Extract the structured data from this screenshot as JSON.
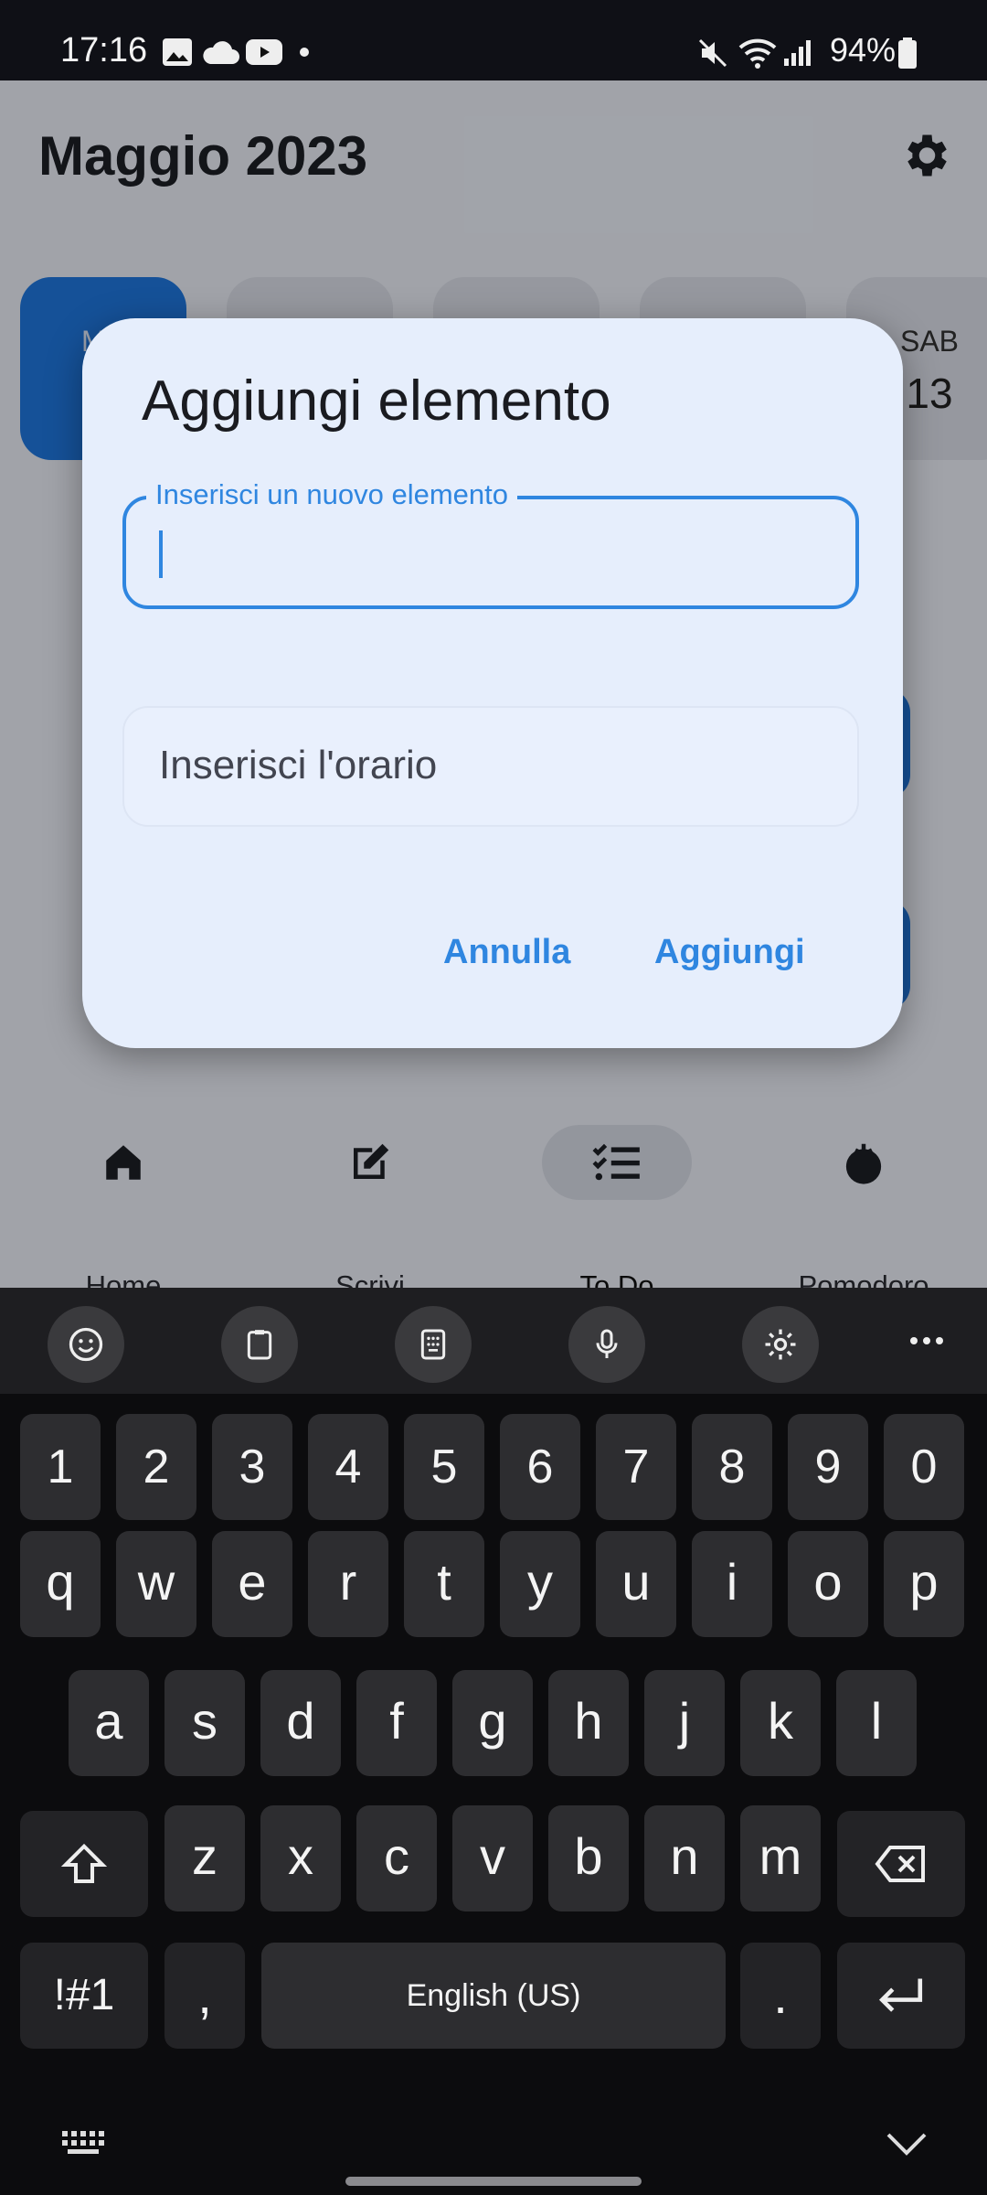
{
  "status_bar": {
    "time": "17:16",
    "battery": "94%"
  },
  "app": {
    "title": "Maggio 2023",
    "days": [
      {
        "abbr": "MA",
        "num": "",
        "selected": true
      },
      {
        "abbr": "",
        "num": "",
        "selected": false
      },
      {
        "abbr": "",
        "num": "",
        "selected": false
      },
      {
        "abbr": "",
        "num": "",
        "selected": false
      },
      {
        "abbr": "SAB",
        "num": "13",
        "selected": false
      }
    ]
  },
  "nav": {
    "items": [
      {
        "label": "Home",
        "icon": "home-icon"
      },
      {
        "label": "Scrivi",
        "icon": "edit-icon"
      },
      {
        "label": "To Do",
        "icon": "checklist-icon",
        "active": true
      },
      {
        "label": "Pomodoro",
        "icon": "tomato-icon"
      }
    ]
  },
  "dialog": {
    "title": "Aggiungi elemento",
    "field_label": "Inserisci un nuovo elemento",
    "field_value": "",
    "time_placeholder": "Inserisci l'orario",
    "cancel_label": "Annulla",
    "add_label": "Aggiungi"
  },
  "keyboard": {
    "toolbar": [
      "emoji-icon",
      "clipboard-icon",
      "keypad-icon",
      "microphone-icon",
      "settings-icon",
      "more-icon"
    ],
    "row_numbers": [
      "1",
      "2",
      "3",
      "4",
      "5",
      "6",
      "7",
      "8",
      "9",
      "0"
    ],
    "row1": [
      "q",
      "w",
      "e",
      "r",
      "t",
      "y",
      "u",
      "i",
      "o",
      "p"
    ],
    "row2": [
      "a",
      "s",
      "d",
      "f",
      "g",
      "h",
      "j",
      "k",
      "l"
    ],
    "row3": [
      "z",
      "x",
      "c",
      "v",
      "b",
      "n",
      "m"
    ],
    "symbols_label": "!#1",
    "comma": ",",
    "space_label": "English (US)",
    "period": "."
  },
  "colors": {
    "accent": "#1f78e0",
    "dialog_bg": "#e6eefc",
    "keyboard_bg": "#0c0c0e"
  }
}
